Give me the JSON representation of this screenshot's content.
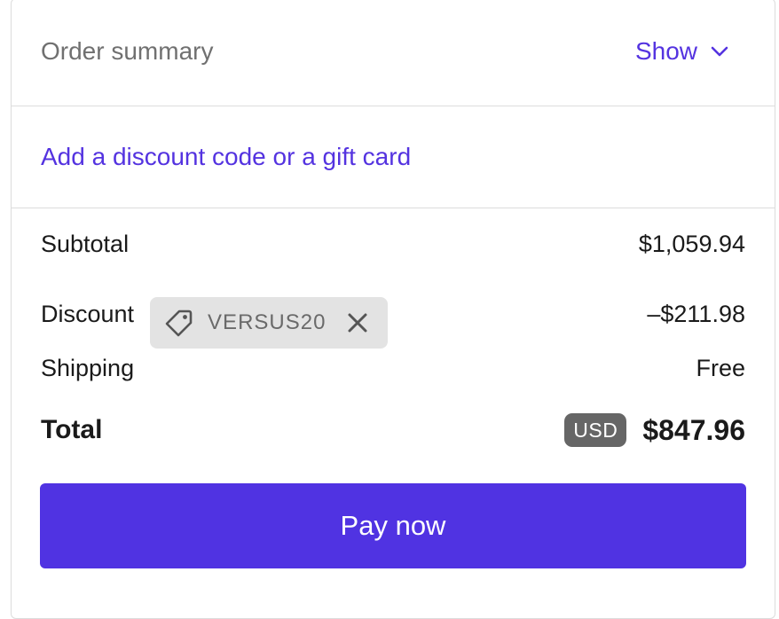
{
  "order_summary": {
    "title": "Order summary",
    "toggle_label": "Show"
  },
  "discount_link": "Add a discount code or a gift card",
  "lines": {
    "subtotal_label": "Subtotal",
    "subtotal_value": "$1,059.94",
    "discount_label": "Discount",
    "discount_code": "VERSUS20",
    "discount_value": "–$211.98",
    "shipping_label": "Shipping",
    "shipping_value": "Free",
    "total_label": "Total",
    "currency": "USD",
    "total_value": "$847.96"
  },
  "pay_button_label": "Pay now",
  "icons": {
    "toggle": "chevron-down-icon",
    "discount_tag": "tag-icon",
    "remove_discount": "close-icon"
  },
  "colors": {
    "accent": "#5433e0",
    "button": "#5033e2",
    "chip_bg": "#e3e3e3",
    "badge_bg": "#666666"
  }
}
